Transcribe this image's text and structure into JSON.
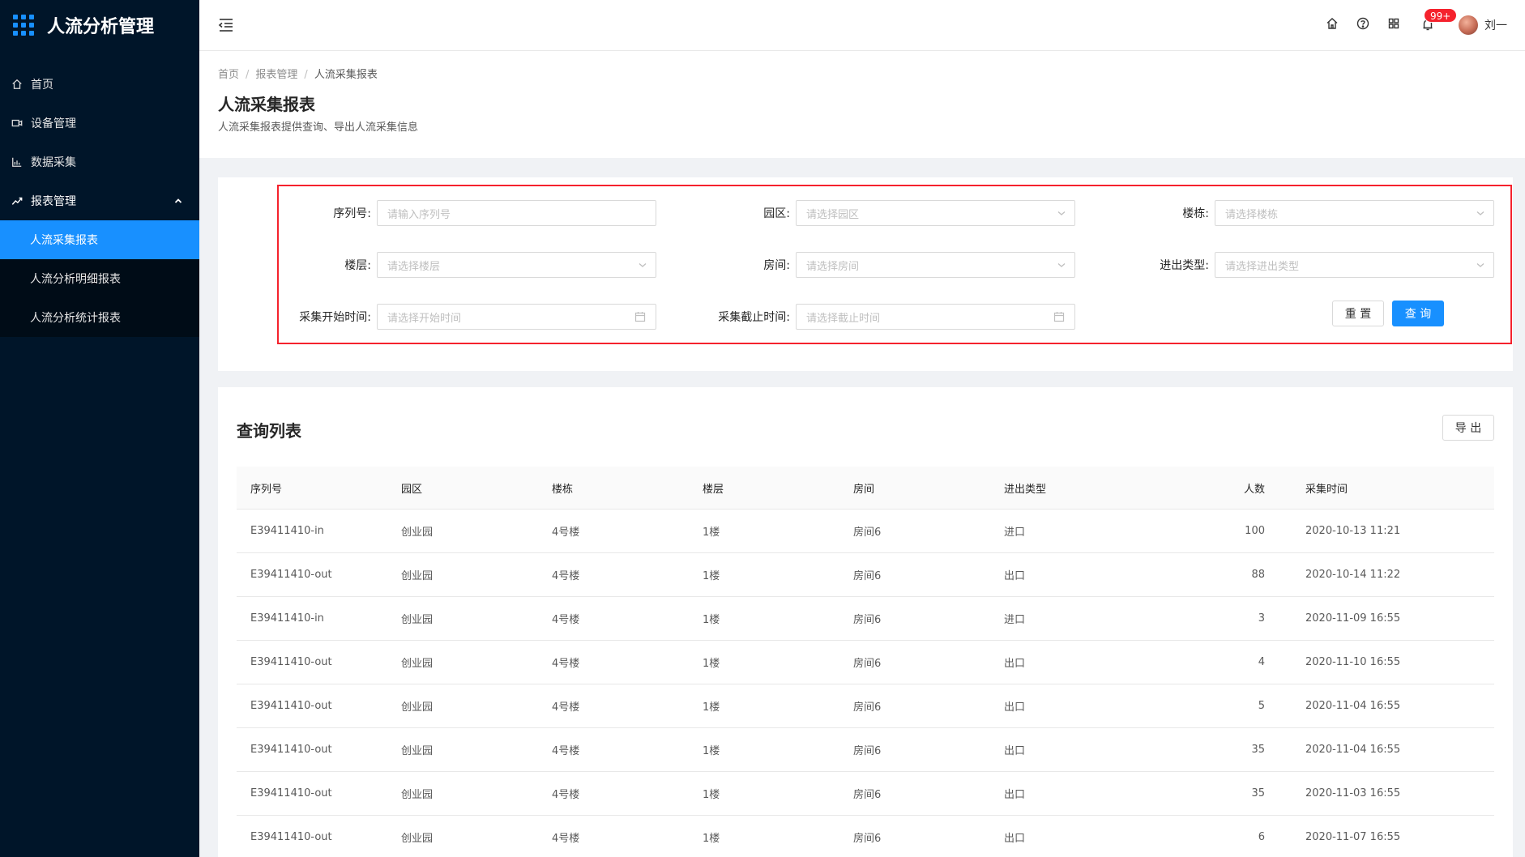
{
  "brand": {
    "title": "人流分析管理"
  },
  "sidebar": {
    "items": [
      {
        "label": "首页"
      },
      {
        "label": "设备管理"
      },
      {
        "label": "数据采集"
      },
      {
        "label": "报表管理"
      }
    ],
    "submenu": [
      {
        "label": "人流采集报表"
      },
      {
        "label": "人流分析明细报表"
      },
      {
        "label": "人流分析统计报表"
      }
    ]
  },
  "header": {
    "badge": "99+",
    "username": "刘一"
  },
  "breadcrumb": [
    "首页",
    "报表管理",
    "人流采集报表"
  ],
  "page": {
    "title": "人流采集报表",
    "subtitle": "人流采集报表提供查询、导出人流采集信息"
  },
  "filters": {
    "serial": {
      "label": "序列号:",
      "placeholder": "请输入序列号"
    },
    "park": {
      "label": "园区:",
      "placeholder": "请选择园区"
    },
    "building": {
      "label": "楼栋:",
      "placeholder": "请选择楼栋"
    },
    "floor": {
      "label": "楼层:",
      "placeholder": "请选择楼层"
    },
    "room": {
      "label": "房间:",
      "placeholder": "请选择房间"
    },
    "io_type": {
      "label": "进出类型:",
      "placeholder": "请选择进出类型"
    },
    "start_time": {
      "label": "采集开始时间:",
      "placeholder": "请选择开始时间"
    },
    "end_time": {
      "label": "采集截止时间:",
      "placeholder": "请选择截止时间"
    },
    "reset_label": "重 置",
    "query_label": "查 询"
  },
  "table": {
    "title": "查询列表",
    "export_label": "导 出",
    "columns": [
      "序列号",
      "园区",
      "楼栋",
      "楼层",
      "房间",
      "进出类型",
      "人数",
      "采集时间"
    ],
    "rows": [
      [
        "E39411410-in",
        "创业园",
        "4号楼",
        "1楼",
        "房间6",
        "进口",
        "100",
        "2020-10-13 11:21"
      ],
      [
        "E39411410-out",
        "创业园",
        "4号楼",
        "1楼",
        "房间6",
        "出口",
        "88",
        "2020-10-14 11:22"
      ],
      [
        "E39411410-in",
        "创业园",
        "4号楼",
        "1楼",
        "房间6",
        "进口",
        "3",
        "2020-11-09 16:55"
      ],
      [
        "E39411410-out",
        "创业园",
        "4号楼",
        "1楼",
        "房间6",
        "出口",
        "4",
        "2020-11-10 16:55"
      ],
      [
        "E39411410-out",
        "创业园",
        "4号楼",
        "1楼",
        "房间6",
        "出口",
        "5",
        "2020-11-04 16:55"
      ],
      [
        "E39411410-out",
        "创业园",
        "4号楼",
        "1楼",
        "房间6",
        "出口",
        "35",
        "2020-11-04 16:55"
      ],
      [
        "E39411410-out",
        "创业园",
        "4号楼",
        "1楼",
        "房间6",
        "出口",
        "35",
        "2020-11-03 16:55"
      ],
      [
        "E39411410-out",
        "创业园",
        "4号楼",
        "1楼",
        "房间6",
        "出口",
        "6",
        "2020-11-07 16:55"
      ]
    ]
  }
}
